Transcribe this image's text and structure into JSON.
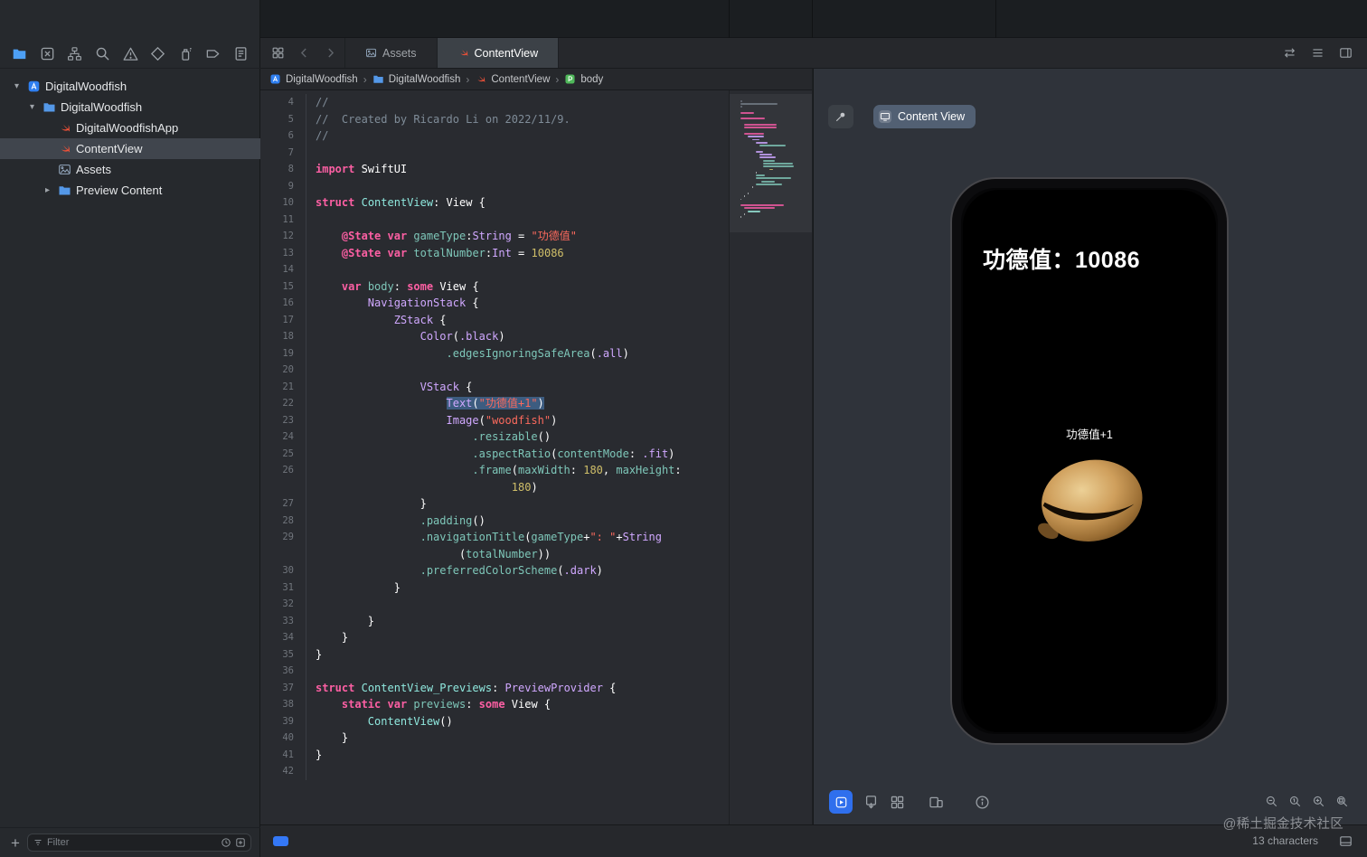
{
  "sidebar": {
    "navigator_icons": [
      {
        "name": "project-navigator",
        "active": true
      },
      {
        "name": "source-control"
      },
      {
        "name": "symbol-navigator"
      },
      {
        "name": "find-navigator"
      },
      {
        "name": "issue-navigator"
      },
      {
        "name": "test-navigator"
      },
      {
        "name": "debug-navigator"
      },
      {
        "name": "breakpoint-navigator"
      },
      {
        "name": "report-navigator"
      }
    ],
    "tree": [
      {
        "label": "DigitalWoodfish",
        "level": 0,
        "icon": "project",
        "disclosure": "open"
      },
      {
        "label": "DigitalWoodfish",
        "level": 1,
        "icon": "folder",
        "disclosure": "open"
      },
      {
        "label": "DigitalWoodfishApp",
        "level": 2,
        "icon": "swift"
      },
      {
        "label": "ContentView",
        "level": 2,
        "icon": "swift",
        "selected": true
      },
      {
        "label": "Assets",
        "level": 2,
        "icon": "assets"
      },
      {
        "label": "Preview Content",
        "level": 2,
        "icon": "folder",
        "disclosure": "closed"
      }
    ],
    "filter": {
      "placeholder": "Filter"
    }
  },
  "editor_header": {
    "tabs": [
      {
        "label": "Assets",
        "icon": "assets"
      },
      {
        "label": "ContentView",
        "icon": "swift",
        "active": true
      }
    ],
    "breadcrumb": [
      {
        "label": "DigitalWoodfish",
        "icon": "project"
      },
      {
        "label": "DigitalWoodfish",
        "icon": "folder"
      },
      {
        "label": "ContentView",
        "icon": "swift"
      },
      {
        "label": "body",
        "icon": "property"
      }
    ]
  },
  "editor": {
    "rows": [
      {
        "n": "4",
        "t": [
          [
            "c",
            "//"
          ]
        ]
      },
      {
        "n": "5",
        "t": [
          [
            "c",
            "//  Created by Ricardo Li on 2022/11/9."
          ]
        ]
      },
      {
        "n": "6",
        "t": [
          [
            "c",
            "//"
          ]
        ]
      },
      {
        "n": "7",
        "t": []
      },
      {
        "n": "8",
        "t": [
          [
            "k",
            "import"
          ],
          [
            "w",
            " SwiftUI"
          ]
        ]
      },
      {
        "n": "9",
        "t": []
      },
      {
        "n": "10",
        "t": [
          [
            "k",
            "struct"
          ],
          [
            "w",
            " "
          ],
          [
            "p",
            "ContentView"
          ],
          [
            "w",
            ": View {"
          ]
        ]
      },
      {
        "n": "11",
        "t": []
      },
      {
        "n": "12",
        "t": [
          [
            "w",
            "    "
          ],
          [
            "k",
            "@State"
          ],
          [
            "w",
            " "
          ],
          [
            "k",
            "var"
          ],
          [
            "w",
            " "
          ],
          [
            "m",
            "gameType"
          ],
          [
            "w",
            ":"
          ],
          [
            "t",
            "String"
          ],
          [
            "w",
            " = "
          ],
          [
            "s",
            "\"功德值\""
          ]
        ]
      },
      {
        "n": "13",
        "t": [
          [
            "w",
            "    "
          ],
          [
            "k",
            "@State"
          ],
          [
            "w",
            " "
          ],
          [
            "k",
            "var"
          ],
          [
            "w",
            " "
          ],
          [
            "m",
            "totalNumber"
          ],
          [
            "w",
            ":"
          ],
          [
            "t",
            "Int"
          ],
          [
            "w",
            " = "
          ],
          [
            "num",
            "10086"
          ]
        ]
      },
      {
        "n": "14",
        "t": []
      },
      {
        "n": "15",
        "t": [
          [
            "w",
            "    "
          ],
          [
            "k",
            "var"
          ],
          [
            "w",
            " "
          ],
          [
            "m",
            "body"
          ],
          [
            "w",
            ": "
          ],
          [
            "k",
            "some"
          ],
          [
            "w",
            " View {"
          ]
        ]
      },
      {
        "n": "16",
        "t": [
          [
            "w",
            "        "
          ],
          [
            "t",
            "NavigationStack"
          ],
          [
            "w",
            " {"
          ]
        ]
      },
      {
        "n": "17",
        "t": [
          [
            "w",
            "            "
          ],
          [
            "t",
            "ZStack"
          ],
          [
            "w",
            " {"
          ]
        ]
      },
      {
        "n": "18",
        "t": [
          [
            "w",
            "                "
          ],
          [
            "t",
            "Color"
          ],
          [
            "w",
            "("
          ],
          [
            "t",
            ".black"
          ],
          [
            "w",
            ")"
          ]
        ]
      },
      {
        "n": "19",
        "t": [
          [
            "w",
            "                    "
          ],
          [
            "m",
            ".edgesIgnoringSafeArea"
          ],
          [
            "w",
            "("
          ],
          [
            "t",
            ".all"
          ],
          [
            "w",
            ")"
          ]
        ]
      },
      {
        "n": "20",
        "t": []
      },
      {
        "n": "21",
        "t": [
          [
            "w",
            "                "
          ],
          [
            "t",
            "VStack"
          ],
          [
            "w",
            " {"
          ]
        ]
      },
      {
        "n": "22",
        "t": [
          [
            "w",
            "                    "
          ],
          [
            "t",
            "Text",
            1
          ],
          [
            "w",
            "(",
            1
          ],
          [
            "s",
            "\"功德值+1\"",
            1
          ],
          [
            "w",
            ")",
            1
          ]
        ]
      },
      {
        "n": "23",
        "t": [
          [
            "w",
            "                    "
          ],
          [
            "t",
            "Image"
          ],
          [
            "w",
            "("
          ],
          [
            "s",
            "\"woodfish\""
          ],
          [
            "w",
            ")"
          ]
        ]
      },
      {
        "n": "24",
        "t": [
          [
            "w",
            "                        "
          ],
          [
            "m",
            ".resizable"
          ],
          [
            "w",
            "()"
          ]
        ]
      },
      {
        "n": "25",
        "t": [
          [
            "w",
            "                        "
          ],
          [
            "m",
            ".aspectRatio"
          ],
          [
            "w",
            "("
          ],
          [
            "m",
            "contentMode"
          ],
          [
            "w",
            ": "
          ],
          [
            "t",
            ".fit"
          ],
          [
            "w",
            ")"
          ]
        ]
      },
      {
        "n": "26",
        "t": [
          [
            "w",
            "                        "
          ],
          [
            "m",
            ".frame"
          ],
          [
            "w",
            "("
          ],
          [
            "m",
            "maxWidth"
          ],
          [
            "w",
            ": "
          ],
          [
            "num",
            "180"
          ],
          [
            "w",
            ", "
          ],
          [
            "m",
            "maxHeight"
          ],
          [
            "w",
            ":"
          ]
        ]
      },
      {
        "n": "",
        "t": [
          [
            "w",
            "                              "
          ],
          [
            "num",
            "180"
          ],
          [
            "w",
            ")"
          ]
        ]
      },
      {
        "n": "27",
        "t": [
          [
            "w",
            "                }"
          ]
        ]
      },
      {
        "n": "28",
        "t": [
          [
            "w",
            "                "
          ],
          [
            "m",
            ".padding"
          ],
          [
            "w",
            "()"
          ]
        ]
      },
      {
        "n": "29",
        "t": [
          [
            "w",
            "                "
          ],
          [
            "m",
            ".navigationTitle"
          ],
          [
            "w",
            "("
          ],
          [
            "m",
            "gameType"
          ],
          [
            "w",
            "+"
          ],
          [
            "s",
            "\": \""
          ],
          [
            "w",
            "+"
          ],
          [
            "t",
            "String"
          ]
        ]
      },
      {
        "n": "",
        "t": [
          [
            "w",
            "                      ("
          ],
          [
            "m",
            "totalNumber"
          ],
          [
            "w",
            "))"
          ]
        ]
      },
      {
        "n": "30",
        "t": [
          [
            "w",
            "                "
          ],
          [
            "m",
            ".preferredColorScheme"
          ],
          [
            "w",
            "("
          ],
          [
            "t",
            ".dark"
          ],
          [
            "w",
            ")"
          ]
        ]
      },
      {
        "n": "31",
        "t": [
          [
            "w",
            "            }"
          ]
        ]
      },
      {
        "n": "32",
        "t": []
      },
      {
        "n": "33",
        "t": [
          [
            "w",
            "        }"
          ]
        ]
      },
      {
        "n": "34",
        "t": [
          [
            "w",
            "    }"
          ]
        ]
      },
      {
        "n": "35",
        "t": [
          [
            "w",
            "}"
          ]
        ]
      },
      {
        "n": "36",
        "t": []
      },
      {
        "n": "37",
        "t": [
          [
            "k",
            "struct"
          ],
          [
            "w",
            " "
          ],
          [
            "p",
            "ContentView_Previews"
          ],
          [
            "w",
            ": "
          ],
          [
            "t",
            "PreviewProvider"
          ],
          [
            "w",
            " {"
          ]
        ]
      },
      {
        "n": "38",
        "t": [
          [
            "w",
            "    "
          ],
          [
            "k",
            "static"
          ],
          [
            "w",
            " "
          ],
          [
            "k",
            "var"
          ],
          [
            "w",
            " "
          ],
          [
            "m",
            "previews"
          ],
          [
            "w",
            ": "
          ],
          [
            "k",
            "some"
          ],
          [
            "w",
            " View {"
          ]
        ]
      },
      {
        "n": "39",
        "t": [
          [
            "w",
            "        "
          ],
          [
            "p",
            "ContentView"
          ],
          [
            "w",
            "()"
          ]
        ]
      },
      {
        "n": "40",
        "t": [
          [
            "w",
            "    }"
          ]
        ]
      },
      {
        "n": "41",
        "t": [
          [
            "w",
            "}"
          ]
        ]
      },
      {
        "n": "42",
        "t": []
      }
    ]
  },
  "canvas": {
    "device_button_label": "Content View",
    "preview": {
      "title": "功德值：10086",
      "caption": "功德值+1",
      "image": "woodfish"
    },
    "bottom_icons": [
      "live-preview",
      "preview-on-device",
      "variants",
      "device-settings",
      "accessibility"
    ],
    "zoom_icons": [
      "zoom-out",
      "zoom-actual-size",
      "zoom-in",
      "zoom-fit"
    ],
    "watermark": "@稀土掘金技术社区"
  },
  "statusbar": {
    "characters": "13 characters"
  }
}
